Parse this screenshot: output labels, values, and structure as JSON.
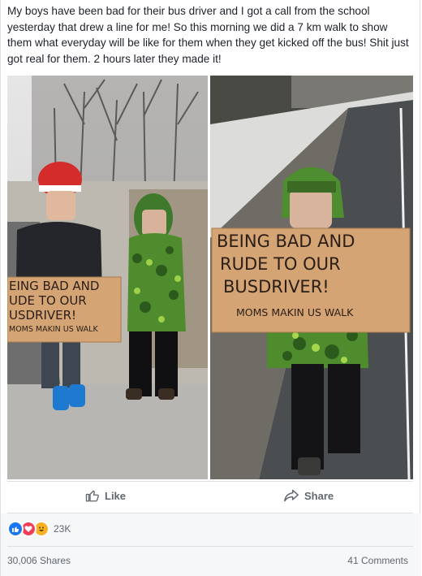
{
  "post": {
    "text": "My boys have been bad for their bus driver and I got a call from the school yesterday that drew a line for me! So this morning we did a 7 km walk to show them what everyday will be like for them when they get kicked off the bus! Shit just got real for them. 2 hours later they made it!"
  },
  "photos": {
    "left": {
      "sign_lines": [
        "EING BAD AND",
        "UDE TO OUR",
        "USDRIVER!",
        "MOMS MAKIN US WALK"
      ]
    },
    "right": {
      "sign_lines": [
        "BEING BAD AND",
        "RUDE TO OUR",
        "BUSDRIVER!",
        "MOMS MAKIN US WALK"
      ]
    }
  },
  "actions": {
    "like_label": "Like",
    "share_label": "Share"
  },
  "reactions": {
    "count": "23K",
    "icons": [
      "like-icon",
      "love-icon",
      "haha-icon"
    ]
  },
  "footer": {
    "shares": "30,006 Shares",
    "comments": "41 Comments"
  },
  "colors": {
    "text": "#1d2129",
    "secondary": "#606770",
    "like_blue": "#1877f2",
    "love_red": "#f33e58",
    "haha_yellow": "#f7b125",
    "cardboard": "#d4a474"
  }
}
